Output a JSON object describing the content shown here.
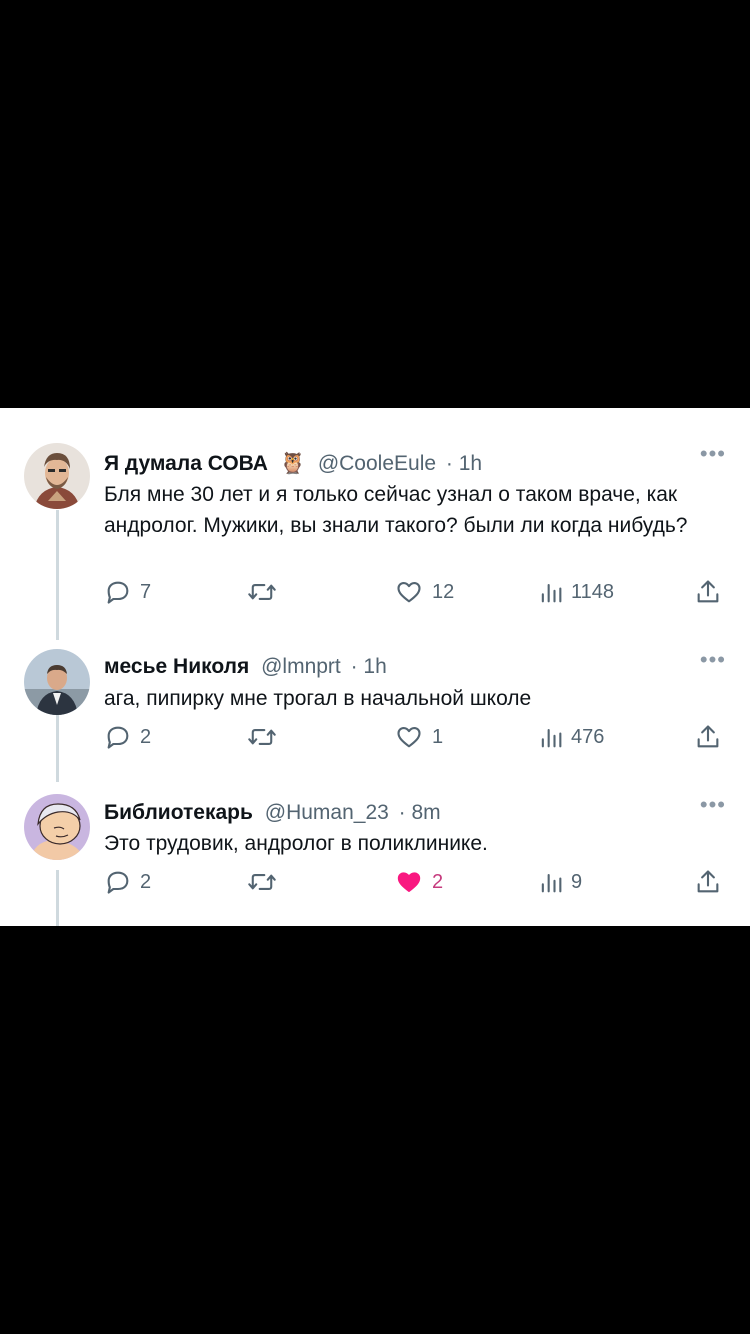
{
  "tweets": [
    {
      "name": "Я думала СОВА",
      "emoji": "🦉",
      "handle": "@CooleEule",
      "time": "· 1h",
      "text": "Бля мне 30 лет и я только сейчас узнал о таком враче, как андролог. Мужики, вы знали такого? были ли когда нибудь?",
      "replies": "7",
      "retweets": "",
      "likes": "12",
      "views": "1148",
      "liked": false
    },
    {
      "name": "месье Николя",
      "handle": "@lmnprt",
      "time": "· 1h",
      "text": "ага, пипирку мне трогал в начальной школе",
      "replies": "2",
      "retweets": "",
      "likes": "1",
      "views": "476",
      "liked": false
    },
    {
      "name": "Библиотекарь",
      "handle": "@Human_23",
      "time": "· 8m",
      "text": "Это трудовик, андролог в поликлинике.",
      "replies": "2",
      "retweets": "",
      "likes": "2",
      "views": "9",
      "liked": true
    }
  ],
  "icons": {
    "more": "more-dots-icon",
    "reply": "reply-bubble-icon",
    "retweet": "retweet-icon",
    "like": "heart-icon",
    "views": "views-bar-chart-icon",
    "share": "share-upload-icon"
  },
  "colors": {
    "text": "#0f1419",
    "secondary": "#536471",
    "like_active": "#f91880",
    "background": "#000000",
    "panel": "#ffffff"
  }
}
